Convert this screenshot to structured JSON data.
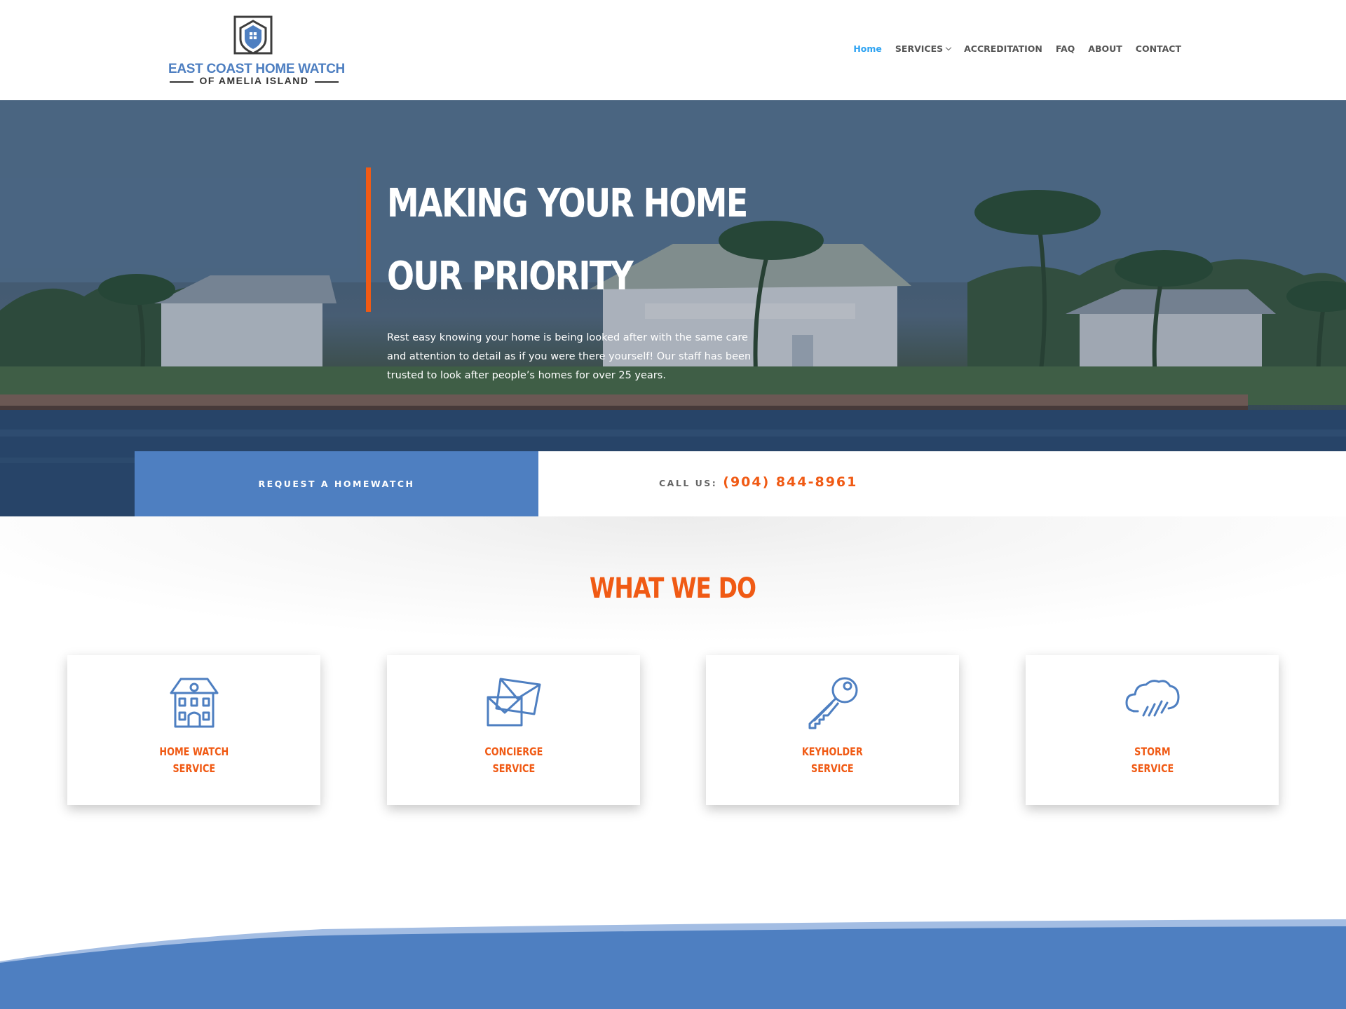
{
  "brand": {
    "line1": "EAST COAST HOME WATCH",
    "line2": "OF AMELIA ISLAND",
    "logo_icon": "house-shield-icon"
  },
  "nav": {
    "items": [
      {
        "label": "Home",
        "active": true
      },
      {
        "label": "SERVICES",
        "has_dropdown": true
      },
      {
        "label": "ACCREDITATION"
      },
      {
        "label": "FAQ"
      },
      {
        "label": "ABOUT"
      },
      {
        "label": "CONTACT"
      }
    ]
  },
  "hero": {
    "title_line1": "MAKING YOUR HOME",
    "title_line2": "OUR PRIORITY",
    "body": "Rest easy knowing your home is being looked after with the same care and attention to detail as if you were there yourself! Our staff has been trusted to look after people’s homes for over 25 years."
  },
  "cta": {
    "request_label": "REQUEST A HOMEWATCH",
    "call_label": "CALL US:",
    "phone": "(904) 844-8961"
  },
  "services": {
    "title": "WHAT WE DO",
    "cards": [
      {
        "line1": "HOME WATCH",
        "line2": "SERVICE",
        "icon": "house-icon"
      },
      {
        "line1": "CONCIERGE",
        "line2": "SERVICE",
        "icon": "envelope-icon"
      },
      {
        "line1": "KEYHOLDER",
        "line2": "SERVICE",
        "icon": "key-icon"
      },
      {
        "line1": "STORM",
        "line2": "SERVICE",
        "icon": "storm-cloud-icon"
      }
    ]
  },
  "colors": {
    "accent_orange": "#f05a14",
    "brand_blue": "#4e7fc1",
    "nav_active": "#2ea3f2"
  }
}
